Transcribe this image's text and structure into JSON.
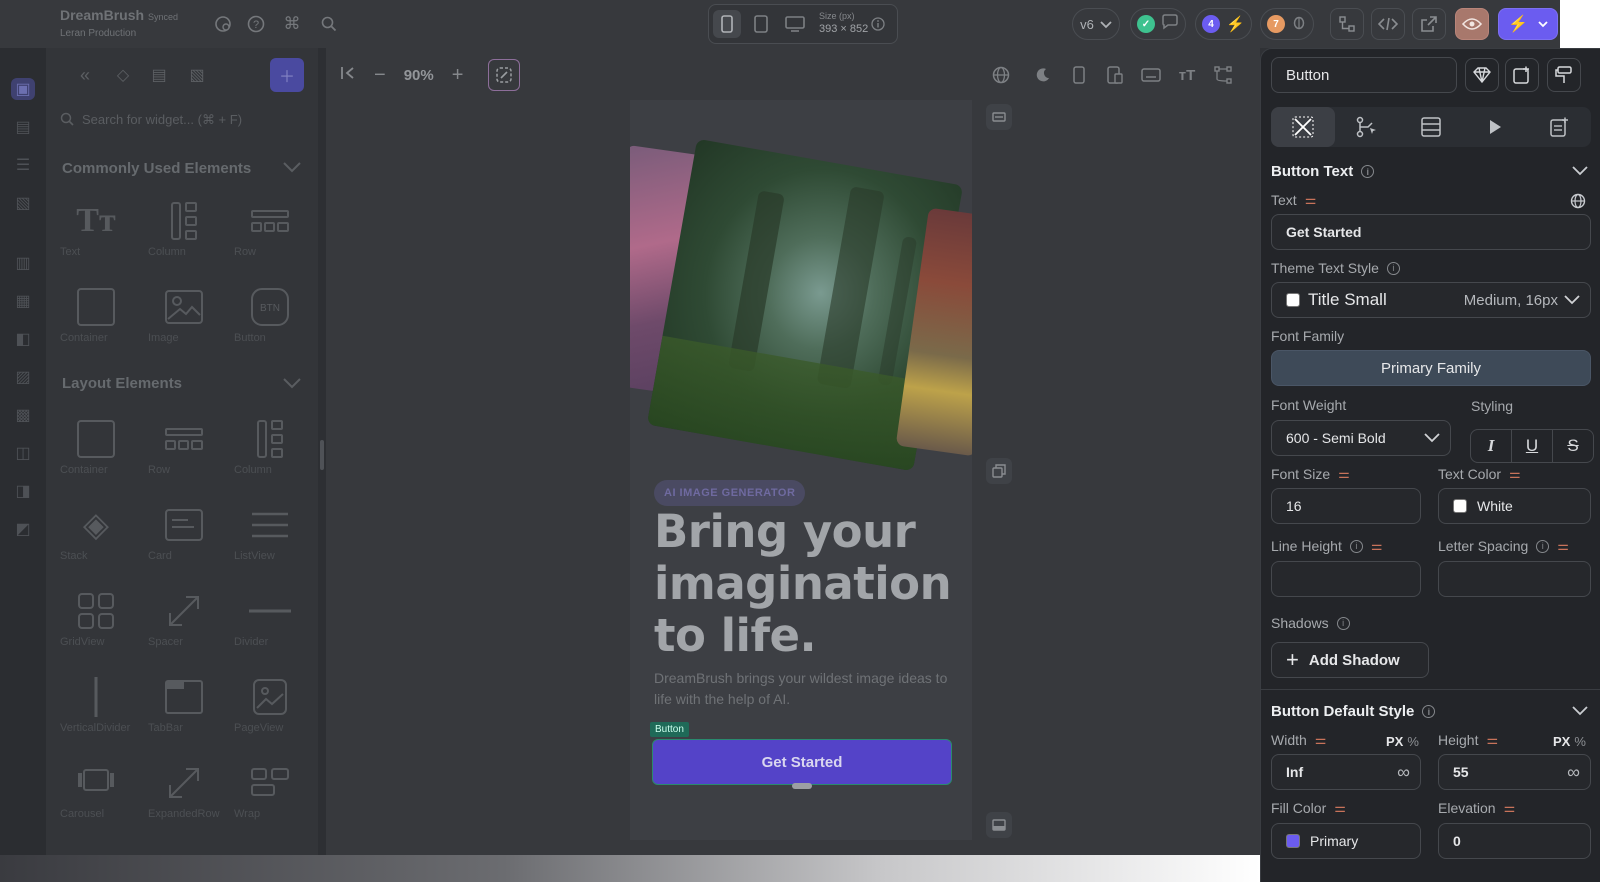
{
  "app": {
    "name": "DreamBrush",
    "sync_status": "Synced",
    "breadcrumb": "Leran  Production"
  },
  "device": {
    "size_label": "Size (px)",
    "size_value": "393 × 852"
  },
  "version": {
    "label": "v6"
  },
  "badges": {
    "count_a": "4",
    "count_b": "7"
  },
  "leftpanel": {
    "search_placeholder": "Search for widget...  (⌘ + F)",
    "common_title": "Commonly Used Elements",
    "common_items": [
      "Text",
      "Column",
      "Row",
      "Container",
      "Image",
      "Button"
    ],
    "layout_title": "Layout Elements",
    "layout_items": [
      "Container",
      "Row",
      "Column",
      "Stack",
      "Card",
      "ListView",
      "GridView",
      "Spacer",
      "Divider",
      "VerticalDivider",
      "TabBar",
      "PageView",
      "Carousel",
      "ExpandedRow",
      "Wrap"
    ]
  },
  "canvas": {
    "zoom": "90%"
  },
  "preview": {
    "tag": "AI IMAGE GENERATOR",
    "headline": "Bring your imagination to life.",
    "body": "DreamBrush brings your wildest image ideas to life with the help of AI.",
    "selection_label": "Button",
    "cta": "Get Started"
  },
  "props": {
    "widget_name": "Button",
    "button_text_title": "Button Text",
    "text_label": "Text",
    "text_value": "Get Started",
    "theme_style_label": "Theme Text Style",
    "theme_style_name": "Title Small",
    "theme_style_meta": "Medium, 16px",
    "font_family_label": "Font Family",
    "font_family_value": "Primary Family",
    "font_weight_label": "Font Weight",
    "font_weight_value": "600 - Semi Bold",
    "styling_label": "Styling",
    "font_size_label": "Font Size",
    "font_size_value": "16",
    "text_color_label": "Text Color",
    "text_color_value": "White",
    "line_height_label": "Line Height",
    "letter_spacing_label": "Letter Spacing",
    "shadows_label": "Shadows",
    "add_shadow": "Add Shadow",
    "default_style_title": "Button Default Style",
    "width_label": "Width",
    "width_value": "Inf",
    "height_label": "Height",
    "height_value": "55",
    "unit_px": "PX",
    "unit_pct": "%",
    "fill_color_label": "Fill Color",
    "fill_color_value": "Primary",
    "elevation_label": "Elevation",
    "elevation_value": "0"
  },
  "colors": {
    "accent": "#6b5cf0",
    "primary_swatch": "#6b5cf0",
    "white_swatch": "#ffffff"
  }
}
